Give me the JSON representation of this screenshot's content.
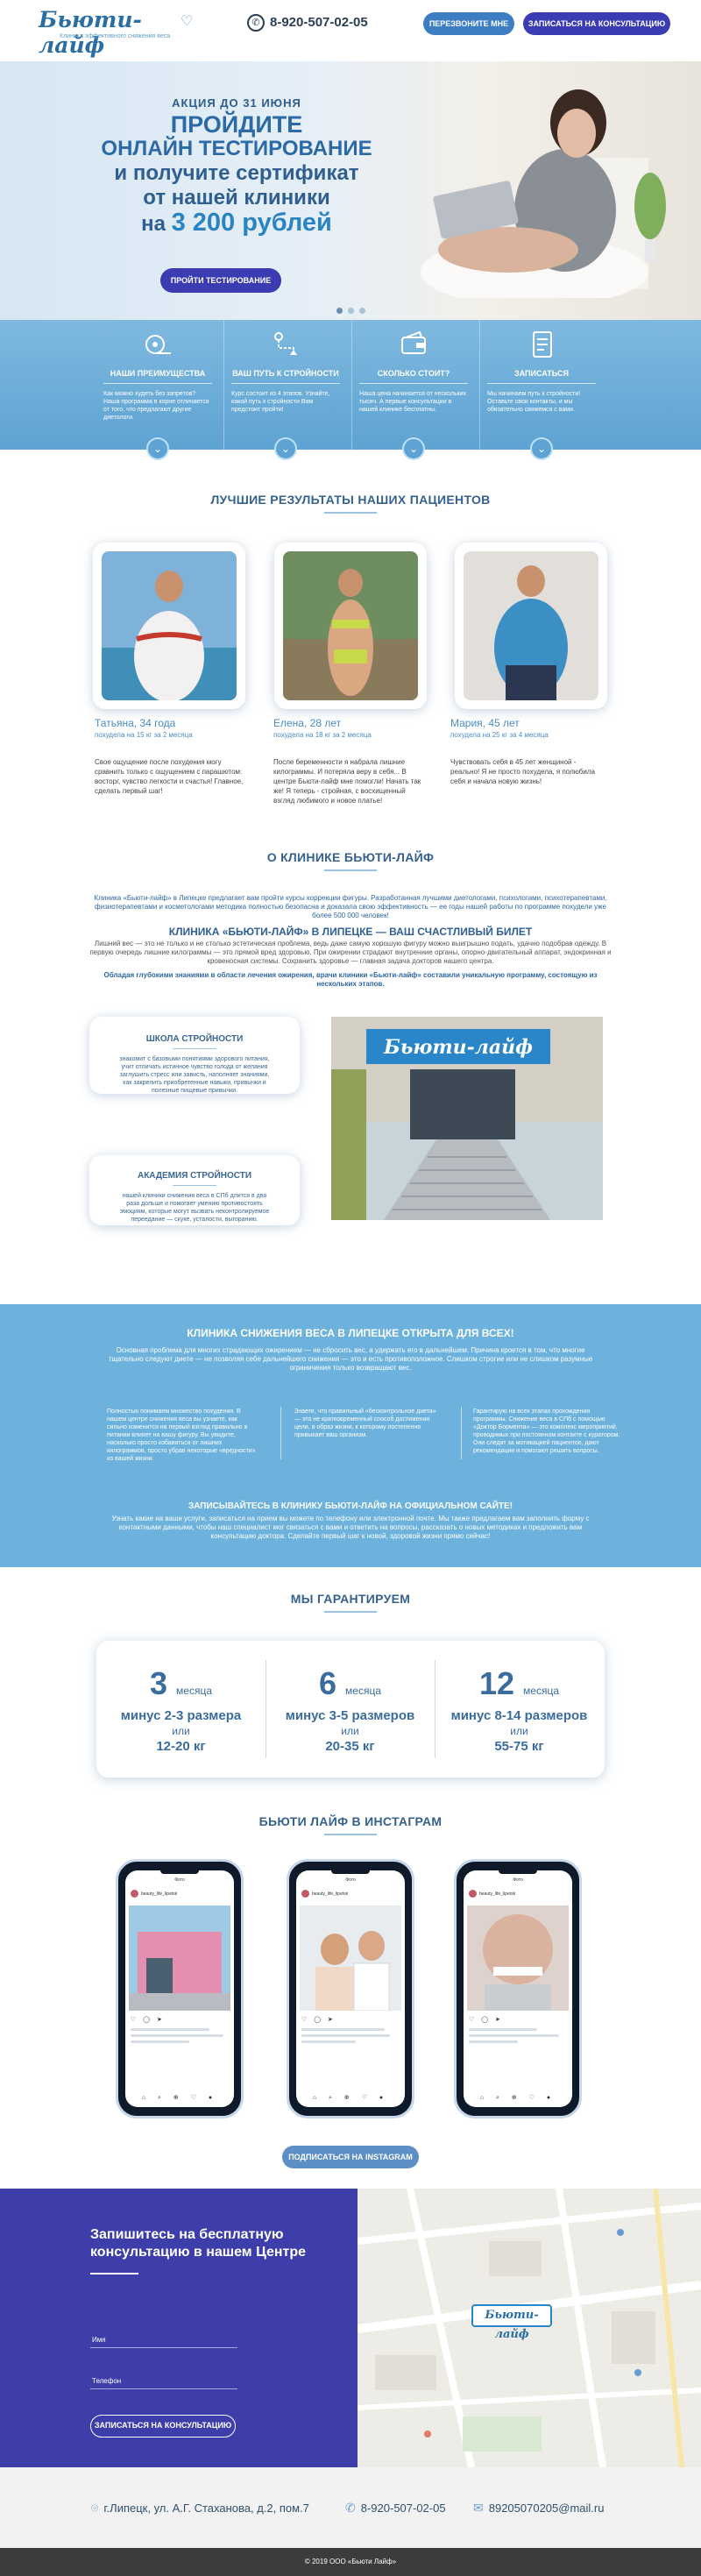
{
  "header": {
    "logo_text": "Бьюти-лайф",
    "logo_tagline": "Клиника эффективного снижения веса",
    "phone": "8-920-507-02-05",
    "callback_button": "ПЕРЕЗВОНИТЕ МНЕ",
    "consult_button": "ЗАПИСАТЬСЯ НА КОНСУЛЬТАЦИЮ"
  },
  "hero": {
    "line1": "АКЦИЯ ДО 31 ИЮНЯ",
    "line2": "ПРОЙДИТЕ",
    "line3": "ОНЛАЙН ТЕСТИРОВАНИЕ",
    "line4": "и получите сертификат",
    "line5": "от нашей клиники",
    "line6_prefix": "на",
    "line6_amount": "3 200 рублей",
    "button": "ПРОЙТИ ТЕСТИРОВАНИЕ",
    "slides_total": 3,
    "slide_active": 1
  },
  "features": [
    {
      "icon": "tape-measure-icon",
      "title": "НАШИ ПРЕИМУЩЕСТВА",
      "text": "Как можно худеть без запретов? Наша программа в корне отличается от того, что предлагают другие диетологи."
    },
    {
      "icon": "route-icon",
      "title": "ВАШ ПУТЬ К СТРОЙНОСТИ",
      "text": "Курс состоит из 4 этапов. Узнайте, какой путь к стройности Вам предстоит пройти!"
    },
    {
      "icon": "wallet-icon",
      "title": "СКОЛЬКО СТОИТ?",
      "text": "Наша цена начинается от нескольких тысяч. А первые консультации в нашей клинике бесплатны."
    },
    {
      "icon": "checklist-icon",
      "title": "ЗАПИСАТЬСЯ",
      "text": "Мы начинаем путь к стройности! Оставьте свои контакты, и мы обязательно свяжемся с вами."
    }
  ],
  "results": {
    "title": "ЛУЧШИЕ РЕЗУЛЬТАТЫ НАШИХ ПАЦИЕНТОВ",
    "items": [
      {
        "name": "Татьяна, 34 года",
        "sub": "похудела на 15 кг за 2 месяца",
        "text": "Свое ощущение после похудения могу сравнить только с ощущением с парашютом: восторг, чувство легкости и счастья! Главное, сделать первый шаг!"
      },
      {
        "name": "Елена, 28 лет",
        "sub": "похудела на 18 кг за 2 месяца",
        "text": "После беременности я набрала лишние килограммы. И потеряла веру в себя... В центре Бьюти-лайф мне помогли! Начать так же! Я теперь - стройная, с восхищенный взгляд любимого и новое платье!"
      },
      {
        "name": "Мария, 45 лет",
        "sub": "похудела на 25 кг за 4 месяца",
        "text": "Чувствовать себя в 45 лет женщиной - реально! Я не просто похудела, я полюбила себя и начала новую жизнь!"
      }
    ]
  },
  "about": {
    "title": "О КЛИНИКЕ БЬЮТИ-ЛАЙФ",
    "p1": "Клиника «Бьюти-лайф» в Липецке предлагает вам пройти курсы коррекции фигуры. Разработанная лучшими диетологами, психологами, психотерапевтами, физиотерапевтами и косметологами методика полностью безопасна и доказала свою эффективность — ее годы нашей работы по программе похудели уже более 500 000 человек!",
    "heading2": "КЛИНИКА «БЬЮТИ-ЛАЙФ» В ЛИПЕЦКЕ — ВАШ СЧАСТЛИВЫЙ БИЛЕТ",
    "p2": "Лишний вес — это не только и не столько эстетическая проблема, ведь даже самую хорошую фигуру можно выигрышно подать, удачно подобрав одежду. В первую очередь лишние килограммы — это прямой вред здоровью. При ожирении страдают внутренние органы, опорно-двигательный аппарат, эндокринная и кровеносная системы. Сохранить здоровье — главная задача докторов нашего центра.",
    "p3": "Обладая глубокими знаниями в области лечения ожирения, врачи клиники «Бьюти-лайф» составили уникальную программу, состоящую из нескольких этапов.",
    "card1_title": "ШКОЛА СТРОЙНОСТИ",
    "card1_text": "знакомит с базовыми понятиями здорового питания, учит отличать истинное чувство голода от желания заглушить стресс или зависть, наполняет знаниями, как закрепить приобретенные навыки, привычки и полезные пищевые привычки.",
    "card2_title": "АКАДЕМИЯ СТРОЙНОСТИ",
    "card2_text": "нашей клиники снижения веса в СПб длится в два раза дольше и помогает умению противостоять эмоциям, которые могут вызвать неконтролируемое переедание — скуке, усталости, выгоранию.",
    "sign": "Бьюти-лайф"
  },
  "band": {
    "title": "КЛИНИКА СНИЖЕНИЯ ВЕСА В ЛИПЕЦКЕ ОТКРЫТА ДЛЯ ВСЕХ!",
    "p1": "Основная проблема для многих страдающих ожирением — не сбросить вес, а удержать его в дальнейшем. Причина кроется в том, что многие тщательно следуют диете — не позволяя себе дальнейшего снижения — это и есть противоположное. Слишком строгие или не слишком разумные ограничения только возвращают вес.",
    "col1": "Полностью понимаем множество похудения. В нашем центре снижения веса вы узнаете, как сильно изменится на первый взгляд правильно в питании влияет на вашу фигуру. Вы увидите, насколько просто избавиться от лишних килограммов, просто убрав некоторые «вредности» из вашей жизни.",
    "col2": "Знаете, что правильный «бесконтрольное диета» — это не кратковременный способ достижения цели, а образ жизни, к которому постепенно привыкает ваш организм.",
    "col3": "Гарантирую на всех этапах прохождения программы. Снижение веса в СПб с помощью «Доктор Бормента» — это комплекс мероприятий, проводимых при постоянном контакте с куратором. Они следят за мотивацией пациентов, дают рекомендации и помогают решить вопросы.",
    "sub_title": "ЗАПИСЫВАЙТЕСЬ В КЛИНИКУ БЬЮТИ-ЛАЙФ НА ОФИЦИАЛЬНОМ САЙТЕ!",
    "p2": "Узнать какие на ваши услуги, записаться на прием вы можете по телефону или электронной почте. Мы также предлагаем вам заполнить форму с контактными данными, чтобы наш специалист мог связаться с вами и ответить на вопросы, рассказать о новых методиках и предложить вам консультацию доктора. Сделайте первый шаг к новой, здоровой жизни прямо сейчас!"
  },
  "guarantee": {
    "title": "МЫ ГАРАНТИРУЕМ",
    "items": [
      {
        "num": "3",
        "unit": "месяца",
        "l1": "минус 2-3 размера",
        "l2": "или",
        "l3": "12-20 кг"
      },
      {
        "num": "6",
        "unit": "месяца",
        "l1": "минус 3-5 размеров",
        "l2": "или",
        "l3": "20-35 кг"
      },
      {
        "num": "12",
        "unit": "месяца",
        "l1": "минус 8-14 размеров",
        "l2": "или",
        "l3": "55-75 кг"
      }
    ]
  },
  "instagram": {
    "title": "БЬЮТИ ЛАЙФ В ИНСТАГРАМ",
    "post_header": "Фото",
    "account": "beauty_life_lipetsk",
    "button": "ПОДПИСАТЬСЯ НА INSTAGRAM"
  },
  "cta": {
    "title": "Запишитесь на бесплатную консультацию в нашем Центре",
    "name_label": "Имя",
    "phone_label": "Телефон",
    "button": "ЗАПИСАТЬСЯ НА КОНСУЛЬТАЦИЮ"
  },
  "map": {
    "marker": "Бьюти-лайф"
  },
  "contacts": {
    "address": "г.Липецк, ул. А.Г. Стаханова, д.2, пом.7",
    "phone": "8-920-507-02-05",
    "email": "89205070205@mail.ru"
  },
  "footer": {
    "copyright": "© 2019 ООО «Бьюти Лайф»"
  },
  "colors": {
    "accent": "#3d7ec3",
    "purple": "#3b3bb2",
    "title": "#35618f",
    "band": "#6cb2dd"
  }
}
